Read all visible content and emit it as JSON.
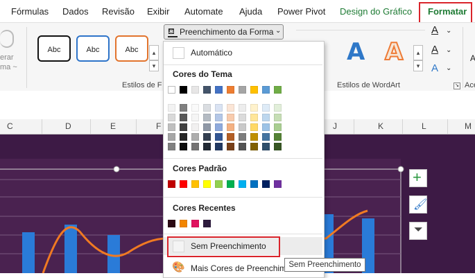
{
  "tabs": [
    {
      "label": "Fórmulas"
    },
    {
      "label": "Dados"
    },
    {
      "label": "Revisão"
    },
    {
      "label": "Exibir"
    },
    {
      "label": "Automate"
    },
    {
      "label": "Ajuda"
    },
    {
      "label": "Power Pivot"
    },
    {
      "label": "Design do Gráfico"
    },
    {
      "label": "Formatar"
    }
  ],
  "ribbon": {
    "left_partial_label_1": "erar",
    "left_partial_label_2": "ma ~",
    "shape_style_sample": "Abc",
    "fill_button_label": "Preenchimento da Forma",
    "shape_styles_group": "Estilos de F",
    "wordart_group": "Estilos de WordArt",
    "wordart_sample": "A",
    "right_partial_label_1": "Ace",
    "right_partial_label_2": "A"
  },
  "columns": [
    "C",
    "D",
    "E",
    "F",
    "J",
    "K",
    "L",
    "M"
  ],
  "dropdown": {
    "automatic": "Automático",
    "theme_colors_title": "Cores do Tema",
    "standard_colors_title": "Cores Padrão",
    "recent_colors_title": "Cores Recentes",
    "no_fill": "Sem Preenchimento",
    "more_colors": "Mais Cores de Preenchim",
    "theme_colors": [
      "#ffffff",
      "#000000",
      "#e7e6e6",
      "#44546a",
      "#4472c4",
      "#ed7d31",
      "#a5a5a5",
      "#ffc000",
      "#5b9bd5",
      "#70ad47"
    ],
    "standard_colors": [
      "#c00000",
      "#ff0000",
      "#ffc000",
      "#ffff00",
      "#92d050",
      "#00b050",
      "#00b0f0",
      "#0070c0",
      "#002060",
      "#7030a0"
    ],
    "recent_colors": [
      "#2b0a14",
      "#f28500",
      "#e0115f",
      "#2d1b3d"
    ]
  },
  "tooltip": "Sem Preenchimento"
}
